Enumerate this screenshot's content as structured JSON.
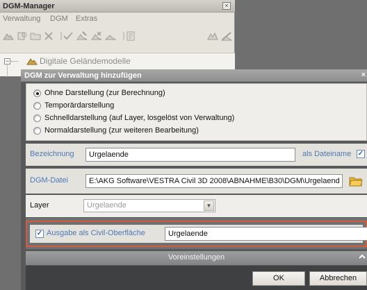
{
  "manager": {
    "title": "DGM-Manager",
    "close_glyph": "×",
    "menu": [
      "Verwaltung",
      "DGM",
      "Extras"
    ],
    "toolbar_icons": [
      "terrain-icon",
      "import-icon",
      "folder-icon",
      "delete-icon",
      "check-icon",
      "terrain-edit-icon",
      "terrain-remove-icon",
      "terrain-small-icon",
      "properties-icon",
      "terrain-merge-icon",
      "terrain-cut-icon"
    ],
    "tree": {
      "expander": "−",
      "node_label": "Digitale Geländemodelle"
    }
  },
  "dialog": {
    "title": "DGM zur Verwaltung hinzufügen",
    "close_glyph": "×",
    "options": [
      {
        "label": "Ohne Darstellung (zur Berechnung)",
        "selected": true
      },
      {
        "label": "Temporärdarstellung",
        "selected": false
      },
      {
        "label": "Schnelldarstellung (auf Layer, losgelöst von Verwaltung)",
        "selected": false
      },
      {
        "label": "Normaldarstellung (zur weiteren Bearbeitung)",
        "selected": false
      }
    ],
    "bezeichnung": {
      "label": "Bezeichnung",
      "value": "Urgelaende",
      "dateiname_label": "als Dateiname",
      "dateiname_checked": true
    },
    "datei": {
      "label": "DGM-Datei",
      "value": "E:\\AKG Software\\VESTRA Civil 3D 2008\\ABNAHME\\B30\\DGM\\Urgelaend"
    },
    "layer": {
      "label": "Layer",
      "value": "Urgelaende"
    },
    "civil": {
      "label": "Ausgabe als Civil-Oberfläche",
      "checked": true,
      "value": "Urgelaende"
    },
    "voreinstellungen_label": "Voreinstellungen",
    "buttons": {
      "ok": "OK",
      "cancel": "Abbrechen"
    }
  },
  "colors": {
    "accent_blue": "#4b79b8",
    "highlight_frame": "#d65a3d"
  }
}
